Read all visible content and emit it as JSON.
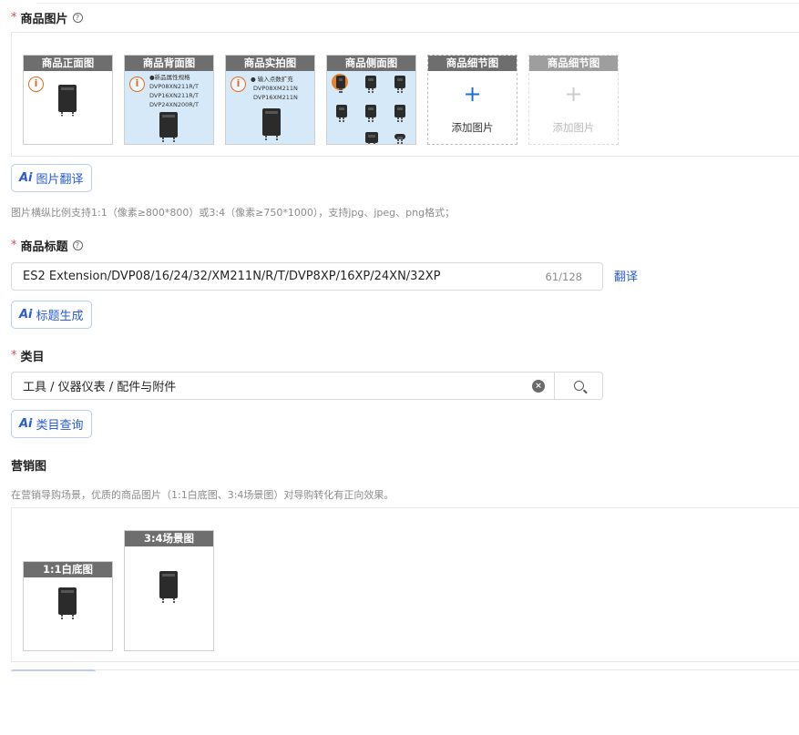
{
  "product_images": {
    "title": "商品图片",
    "required_mark": "*",
    "help_icon": "?",
    "slots": [
      {
        "caption": "商品正面图",
        "kind": "photo"
      },
      {
        "caption": "商品背面图",
        "kind": "photo",
        "lines": [
          "●新品属性规格",
          "DVP08XN211R/T",
          "DVP16XN211R/T",
          "DVP24XN200R/T"
        ]
      },
      {
        "caption": "商品实拍图",
        "kind": "photo",
        "lines": [
          "● 输入点数扩充",
          "DVP08XM211N",
          "DVP16XM211N"
        ]
      },
      {
        "caption": "商品侧面图",
        "kind": "photo"
      },
      {
        "caption": "商品细节图",
        "kind": "add",
        "add_label": "添加图片",
        "plus": "+"
      },
      {
        "caption": "商品细节图",
        "kind": "add-disabled",
        "add_label": "添加图片",
        "plus": "+"
      }
    ],
    "warn_glyph": "i"
  },
  "image_translate_button": {
    "ai": "Ai",
    "label": "图片翻译"
  },
  "image_hint": "图片横纵比例支持1:1（像素≥800*800）或3:4（像素≥750*1000），支持jpg、jpeg、png格式；",
  "product_title": {
    "title": "商品标题",
    "required_mark": "*",
    "help_icon": "?",
    "value": "ES2 Extension/DVP08/16/24/32/XM211N/R/T/DVP8XP/16XP/24XN/32XP",
    "count": "61/128",
    "translate_link": "翻译"
  },
  "title_generate_button": {
    "ai": "Ai",
    "label": "标题生成"
  },
  "category": {
    "title": "类目",
    "required_mark": "*",
    "value": "工具 / 仪器仪表 / 配件与附件",
    "clear_glyph": "×"
  },
  "category_query_button": {
    "ai": "Ai",
    "label": "类目查询"
  },
  "marketing": {
    "title": "营销图",
    "hint": "在营销导购场景，优质的商品图片（1:1白底图、3:4场景图）对导购转化有正向效果。",
    "slots": [
      {
        "caption": "1:1白底图"
      },
      {
        "caption": "3:4场景图"
      }
    ]
  }
}
